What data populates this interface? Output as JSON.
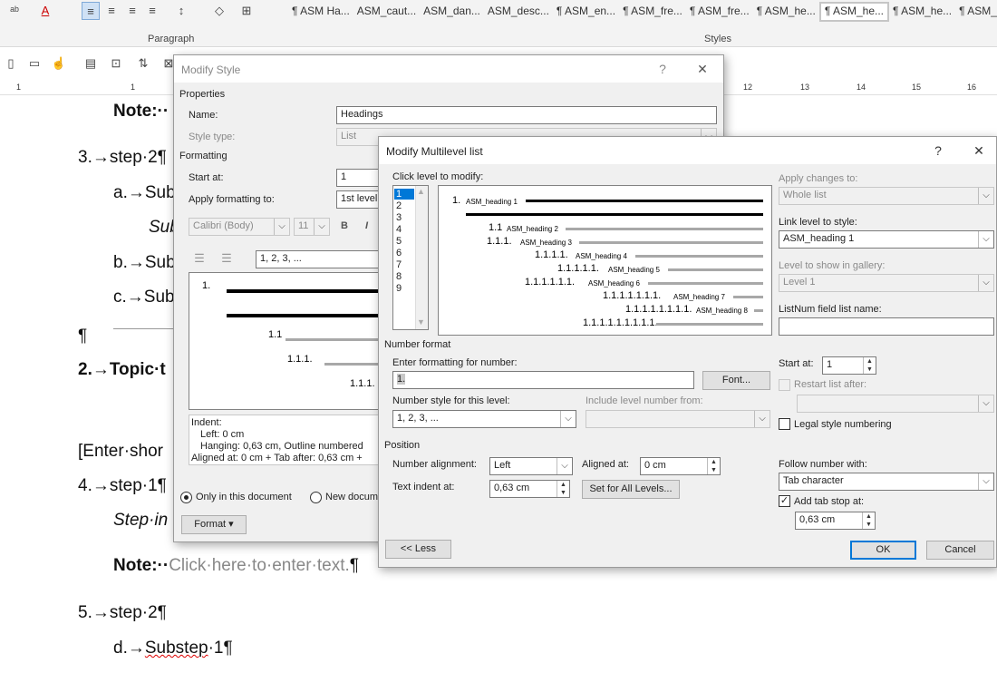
{
  "ribbon": {
    "paragraph_label": "Paragraph",
    "styles_label": "Styles",
    "style_items": [
      "¶ ASM Ha...",
      "ASM_caut...",
      "ASM_dan...",
      "ASM_desc...",
      "¶ ASM_en...",
      "¶ ASM_fre...",
      "¶ ASM_fre...",
      "¶ ASM_he...",
      "¶ ASM_he...",
      "¶ ASM_he...",
      "¶ ASM_he"
    ]
  },
  "ruler": {
    "left": [
      "1",
      "1"
    ],
    "right": [
      "12",
      "13",
      "14",
      "15",
      "16"
    ]
  },
  "document": {
    "note1": "Note:··",
    "step3": "3.→step·2¶",
    "sub_a": "a.→Sub",
    "sub_a2": "Sub",
    "sub_b": "b.→Sub",
    "sub_c": "c.→Sub",
    "pilcrow": "¶",
    "topic2": "2.→Topic·t",
    "enter": "[Enter·shor",
    "step4": "4.→step·1¶",
    "stepin": "Step·in",
    "note2_bold": "Note:··",
    "note2_gray": "Click·here·to·enter·text.",
    "note2_end": "¶",
    "step5": "5.→step·2¶",
    "sub_d_prefix": "d.→",
    "sub_d_word": "Substep",
    "sub_d_rest": "·1¶"
  },
  "modify_style": {
    "title": "Modify Style",
    "help": "?",
    "close": "✕",
    "properties": "Properties",
    "name_label": "Name:",
    "name_value": "Headings",
    "type_label": "Style type:",
    "type_value": "List",
    "formatting": "Formatting",
    "start_label": "Start at:",
    "start_value": "1",
    "apply_label": "Apply formatting to:",
    "apply_value": "1st level",
    "font_value": "Calibri (Body)",
    "size_value": "11",
    "bold": "B",
    "italic": "I",
    "numfmt_value": "1, 2, 3, ...",
    "preview_1": "1.",
    "preview_11": "1.1",
    "preview_111": "1.1.1.",
    "preview_1111": "1.1.1.",
    "desc_1": "Indent:",
    "desc_2": "Left:  0 cm",
    "desc_3": "Hanging:  0,63 cm, Outline numbered",
    "desc_4": "Aligned at:  0 cm + Tab after:  0,63 cm +",
    "only_doc": "Only in this document",
    "new_doc": "New docum",
    "format_btn": "Format ▾"
  },
  "multilevel": {
    "title": "Modify Multilevel list",
    "help": "?",
    "close": "✕",
    "click_level": "Click level to modify:",
    "levels": [
      "1",
      "2",
      "3",
      "4",
      "5",
      "6",
      "7",
      "8",
      "9"
    ],
    "preview": {
      "l1_num": "1.",
      "l1_style": "ASM_heading 1",
      "l2_num": "1.1",
      "l2_style": "ASM_heading 2",
      "l3_num": "1.1.1.",
      "l3_style": "ASM_heading 3",
      "l4_num": "1.1.1.1.",
      "l4_style": "ASM_heading 4",
      "l5_num": "1.1.1.1.1.",
      "l5_style": "ASM_heading 5",
      "l6_num": "1.1.1.1.1.1.",
      "l6_style": "ASM_heading 6",
      "l7_num": "1.1.1.1.1.1.1.",
      "l7_style": "ASM_heading 7",
      "l8_num": "1.1.1.1.1.1.1.1.",
      "l8_style": "ASM_heading 8",
      "l9_num": "1.1.1.1.1.1.1.1.1."
    },
    "apply_changes_label": "Apply changes to:",
    "apply_changes_value": "Whole list",
    "link_label": "Link level to style:",
    "link_value": "ASM_heading 1",
    "gallery_label": "Level to show in gallery:",
    "gallery_value": "Level 1",
    "listnum_label": "ListNum field list name:",
    "listnum_value": "",
    "number_format": "Number format",
    "enter_fmt_label": "Enter formatting for number:",
    "enter_fmt_value": "1.",
    "font_btn": "Font...",
    "style_label": "Number style for this level:",
    "style_value": "1, 2, 3, ...",
    "include_label": "Include level number from:",
    "include_value": "",
    "start_label": "Start at:",
    "start_value": "1",
    "restart_label": "Restart list after:",
    "restart_value": "",
    "legal_label": "Legal style numbering",
    "position": "Position",
    "align_label": "Number alignment:",
    "align_value": "Left",
    "aligned_at_label": "Aligned at:",
    "aligned_at_value": "0 cm",
    "text_indent_label": "Text indent at:",
    "text_indent_value": "0,63 cm",
    "set_all_btn": "Set for All Levels...",
    "follow_label": "Follow number with:",
    "follow_value": "Tab character",
    "add_tab_label": "Add tab stop at:",
    "add_tab_value": "0,63 cm",
    "less_btn": "<< Less",
    "ok_btn": "OK",
    "cancel_btn": "Cancel"
  }
}
